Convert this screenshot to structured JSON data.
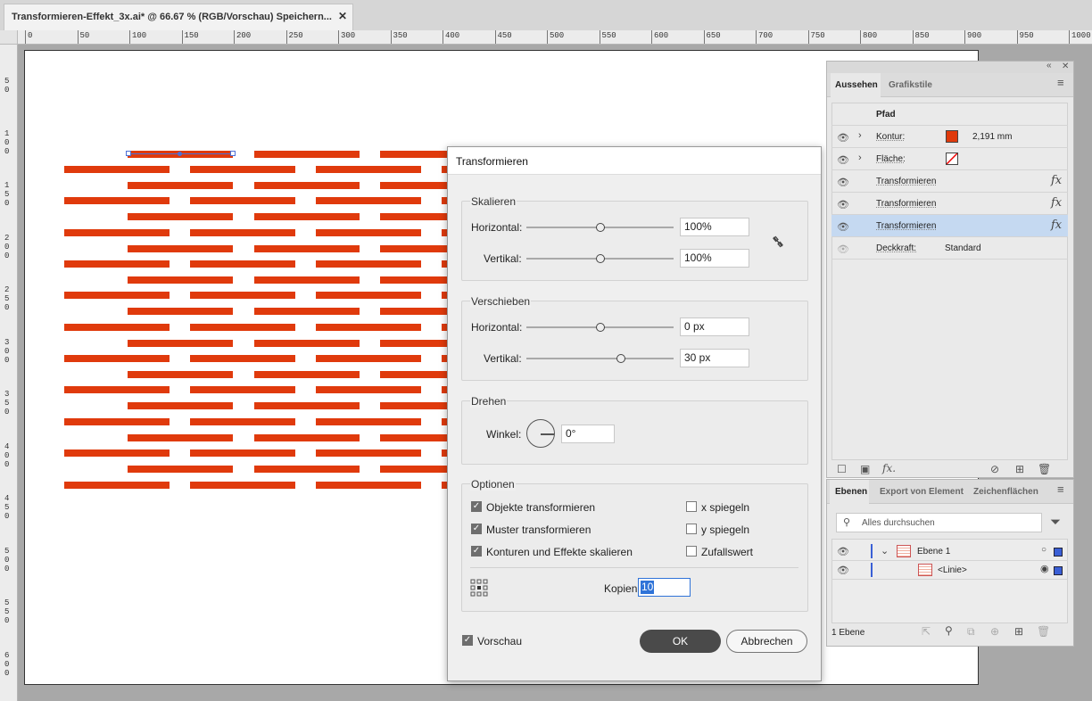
{
  "document_tab": {
    "title": "Transformieren-Effekt_3x.ai* @ 66.67 % (RGB/Vorschau) Speichern...",
    "close": "✕"
  },
  "ruler": {
    "h_labels": [
      "0",
      "50",
      "100",
      "150",
      "200",
      "250",
      "300",
      "350",
      "400",
      "450",
      "500",
      "550",
      "600",
      "650",
      "700",
      "750",
      "800",
      "850",
      "900",
      "950",
      "1000"
    ],
    "v_labels": [
      "5 0",
      "1 0 0",
      "1 5 0",
      "2 0 0",
      "2 5 0",
      "3 0 0",
      "3 5 0",
      "4 0 0",
      "4 5 0",
      "5 0 0",
      "5 5 0",
      "6 0 0"
    ]
  },
  "colors": {
    "artwork": "#e03a0c",
    "selection": "#4b6fd6",
    "accent": "#2f73d8"
  },
  "dialog": {
    "title": "Transformieren",
    "scale": {
      "group_title": "Skalieren",
      "horizontal_label": "Horizontal:",
      "horizontal_value": "100%",
      "vertical_label": "Vertikal:",
      "vertical_value": "100%",
      "link_icon": "chain-broken-icon"
    },
    "move": {
      "group_title": "Verschieben",
      "horizontal_label": "Horizontal:",
      "horizontal_value": "0 px",
      "vertical_label": "Vertikal:",
      "vertical_value": "30 px"
    },
    "rotate": {
      "group_title": "Drehen",
      "angle_label": "Winkel:",
      "angle_value": "0°"
    },
    "options": {
      "group_title": "Optionen",
      "transform_objects": "Objekte transformieren",
      "transform_patterns": "Muster transformieren",
      "scale_strokes": "Konturen und Effekte skalieren",
      "reflect_x": "x spiegeln",
      "reflect_y": "y spiegeln",
      "random": "Zufallswert",
      "checked_transform_objects": true,
      "checked_transform_patterns": true,
      "checked_scale_strokes": true,
      "checked_reflect_x": false,
      "checked_reflect_y": false,
      "checked_random": false,
      "copies_label": "Kopien",
      "copies_value": "10"
    },
    "preview_label": "Vorschau",
    "preview_checked": true,
    "ok_label": "OK",
    "cancel_label": "Abbrechen"
  },
  "appearance_panel": {
    "tabs": [
      "Aussehen",
      "Grafikstile"
    ],
    "header": "Pfad",
    "rows": [
      {
        "label": "Kontur:",
        "value": "2,191 mm"
      },
      {
        "label": "Fläche:"
      },
      {
        "label": "Transformieren"
      },
      {
        "label": "Transformieren"
      },
      {
        "label": "Transformieren"
      },
      {
        "label": "Deckkraft:",
        "value": "Standard"
      }
    ]
  },
  "layers_panel": {
    "tabs": [
      "Ebenen",
      "Export von Element",
      "Zeichenflächen"
    ],
    "search_placeholder": "Alles durchsuchen",
    "layers": [
      {
        "name": "Ebene 1"
      },
      {
        "name": "<Linie>"
      }
    ],
    "footer_count": "1 Ebene"
  }
}
